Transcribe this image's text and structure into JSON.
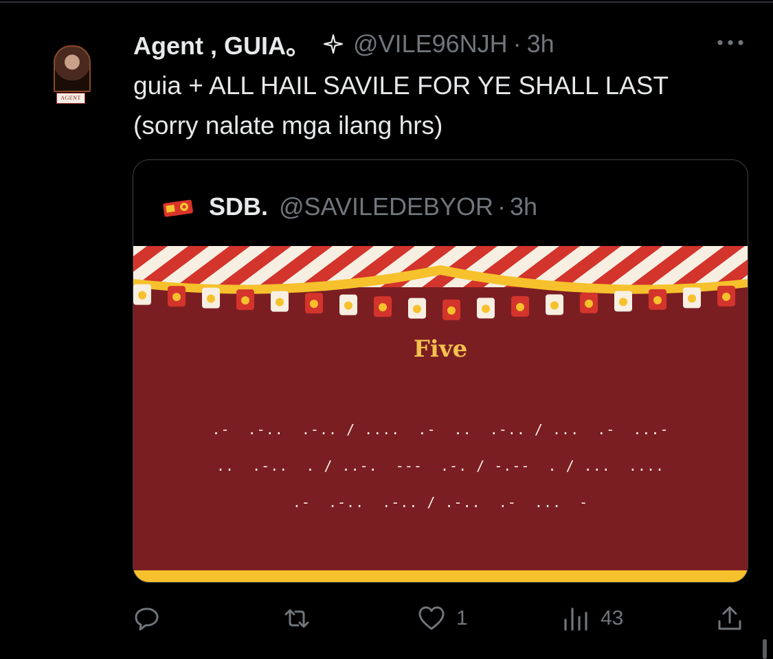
{
  "tweet": {
    "display_name": "Agent , GUIA。",
    "handle": "@VILE96NJH",
    "separator": "·",
    "time": "3h",
    "text": "guia + ALL HAIL SAVILE FOR YE SHALL LAST (sorry nalate mga ilang hrs)",
    "avatar_label": "AGENT"
  },
  "quote": {
    "name": "SDB.",
    "handle": "@SAVILEDEBYOR",
    "separator": "·",
    "time": "3h",
    "media": {
      "title": "Five",
      "lines": [
        ".-  .-..  .-.. / ....  .-  ..  .-.. / ...  .-  ...-",
        "..  .-..  . / ..-.  ---  .-. / -.--  . / ...  ....",
        ".-  .-..  .-.. / .-..  .-  ...  -"
      ]
    }
  },
  "actions": {
    "reply": {
      "icon": "reply-icon"
    },
    "retweet": {
      "icon": "retweet-icon"
    },
    "like": {
      "icon": "heart-icon",
      "count": "1"
    },
    "views": {
      "icon": "views-icon",
      "count": "43"
    },
    "share": {
      "icon": "share-icon"
    }
  },
  "colors": {
    "background": "#000000",
    "text_primary": "#e7e9ea",
    "text_secondary": "#71767b",
    "card_border": "#3e4144",
    "circus_red": "#7b1e22",
    "stripe_red": "#d3342c",
    "stripe_cream": "#f6efe2",
    "gold": "#f6c12c"
  }
}
